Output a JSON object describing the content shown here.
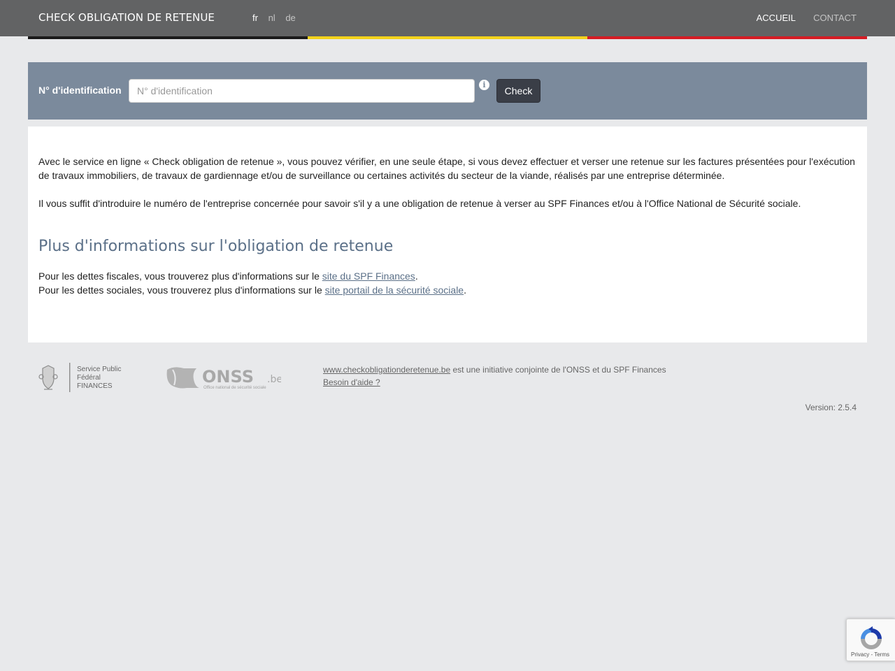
{
  "navbar": {
    "brand": "CHECK OBLIGATION DE RETENUE",
    "languages": [
      {
        "label": "fr",
        "active": true
      },
      {
        "label": "nl",
        "active": false
      },
      {
        "label": "de",
        "active": false
      }
    ],
    "links": [
      {
        "label": "ACCUEIL",
        "active": true
      },
      {
        "label": "CONTACT",
        "active": false
      }
    ]
  },
  "flag_colors": [
    "#1b1b1b",
    "#f2d21b",
    "#d51c24"
  ],
  "search": {
    "label": "N° d'identification",
    "placeholder": "N° d'identification",
    "value": "",
    "info_icon": "info-circle-icon",
    "button_label": "Check"
  },
  "intro": {
    "paragraph1": "Avec le service en ligne « Check obligation de retenue », vous pouvez vérifier, en une seule étape, si vous devez effectuer et verser une retenue sur les factures présentées pour l'exécution de travaux immobiliers, de travaux de gardiennage et/ou de surveillance ou certaines activités du secteur de la viande, réalisés par une entreprise déterminée.",
    "paragraph2": "Il vous suffit d'introduire le numéro de l'entreprise concernée pour savoir s'il y a une obligation de retenue à verser au SPF Finances et/ou à l'Office National de Sécurité sociale."
  },
  "more_info": {
    "title": "Plus d'informations sur l'obligation de retenue",
    "line1_prefix": "Pour les dettes fiscales, vous trouverez plus d'informations sur le ",
    "line1_link": "site du SPF Finances",
    "line1_suffix": ".",
    "line2_prefix": "Pour les dettes sociales, vous trouverez plus d'informations sur le ",
    "line2_link": "site portail de la sécurité sociale",
    "line2_suffix": "."
  },
  "footer": {
    "spf_logo": {
      "line1": "Service Public",
      "line2": "Fédéral",
      "line3": "FINANCES"
    },
    "onss_logo": {
      "name": "ONSS",
      "suffix": ".be",
      "tagline": "Office national de sécurité sociale"
    },
    "site_link": "www.checkobligationderetenue.be",
    "initiative_text": " est une initiative conjointe de l'ONSS et du SPF Finances",
    "help_link": "Besoin d'aide ?",
    "version": "Version: 2.5.4"
  },
  "recaptcha": {
    "privacy": "Privacy",
    "separator": " - ",
    "terms": "Terms"
  },
  "colors": {
    "navbar": "#626364",
    "search_band": "#7b8a9c",
    "accent_title": "#5b7088",
    "button": "#3a3e47",
    "page_background": "#e8e9eb"
  }
}
